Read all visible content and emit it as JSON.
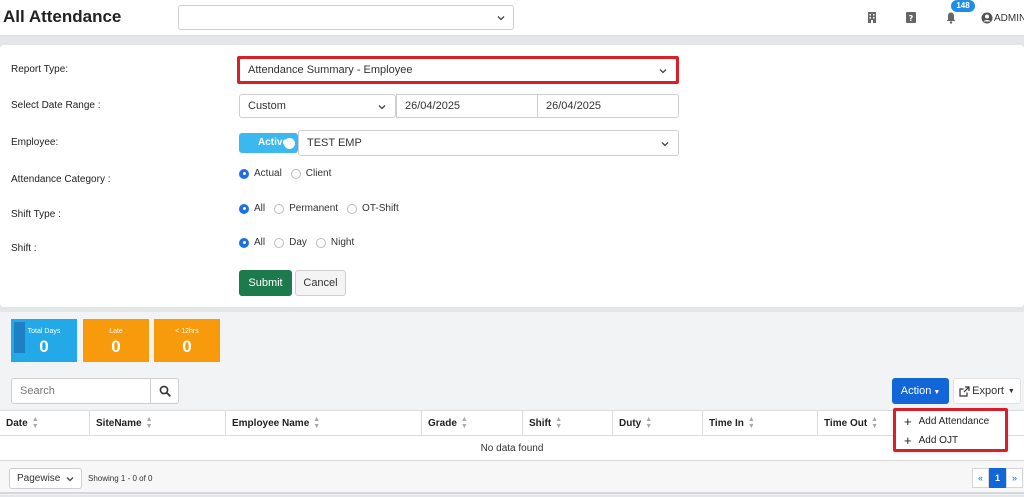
{
  "header": {
    "title": "All Attendance",
    "top_select_value": "",
    "notification_count": "148",
    "user_name": "ADMIN",
    "icons": [
      "building-icon",
      "help-icon",
      "bell-icon",
      "user-icon"
    ]
  },
  "form": {
    "report_type": {
      "label": "Report Type:",
      "value": "Attendance Summary - Employee"
    },
    "date_range": {
      "label": "Select Date Range :",
      "type_value": "Custom",
      "from": "26/04/2025",
      "to": "26/04/2025"
    },
    "employee": {
      "label": "Employee:",
      "toggle_label": "Active",
      "value": "TEST EMP"
    },
    "attendance_category": {
      "label": "Attendance Category :",
      "options": [
        "Actual",
        "Client"
      ],
      "selected": "Actual"
    },
    "shift_type": {
      "label": "Shift Type :",
      "options": [
        "All",
        "Permanent",
        "OT-Shift"
      ],
      "selected": "All"
    },
    "shift": {
      "label": "Shift :",
      "options": [
        "All",
        "Day",
        "Night"
      ],
      "selected": "All"
    },
    "submit_label": "Submit",
    "cancel_label": "Cancel"
  },
  "stats": [
    {
      "title": "Total Days",
      "value": "0",
      "color": "#23a8e8"
    },
    {
      "title": "Late",
      "value": "0",
      "color": "#f79a0c"
    },
    {
      "title": "< 12hrs",
      "value": "0",
      "color": "#f79a0c"
    }
  ],
  "toolbar": {
    "search_placeholder": "Search",
    "action_label": "Action",
    "export_label": "Export"
  },
  "table": {
    "columns": [
      "Date",
      "SiteName",
      "Employee Name",
      "Grade",
      "Shift",
      "Duty",
      "Time In",
      "Time Out"
    ],
    "empty_message": "No data found"
  },
  "action_menu": {
    "items": [
      "Add Attendance",
      "Add OJT"
    ]
  },
  "footer": {
    "pagewise_label": "Pagewise",
    "showing_text": "Showing 1 - 0 of 0",
    "pager": [
      "«",
      "1",
      "»"
    ],
    "current_page": "1"
  },
  "colors": {
    "highlight": "#d8202a",
    "primary": "#1266d8",
    "submit": "#1d7a4c"
  }
}
